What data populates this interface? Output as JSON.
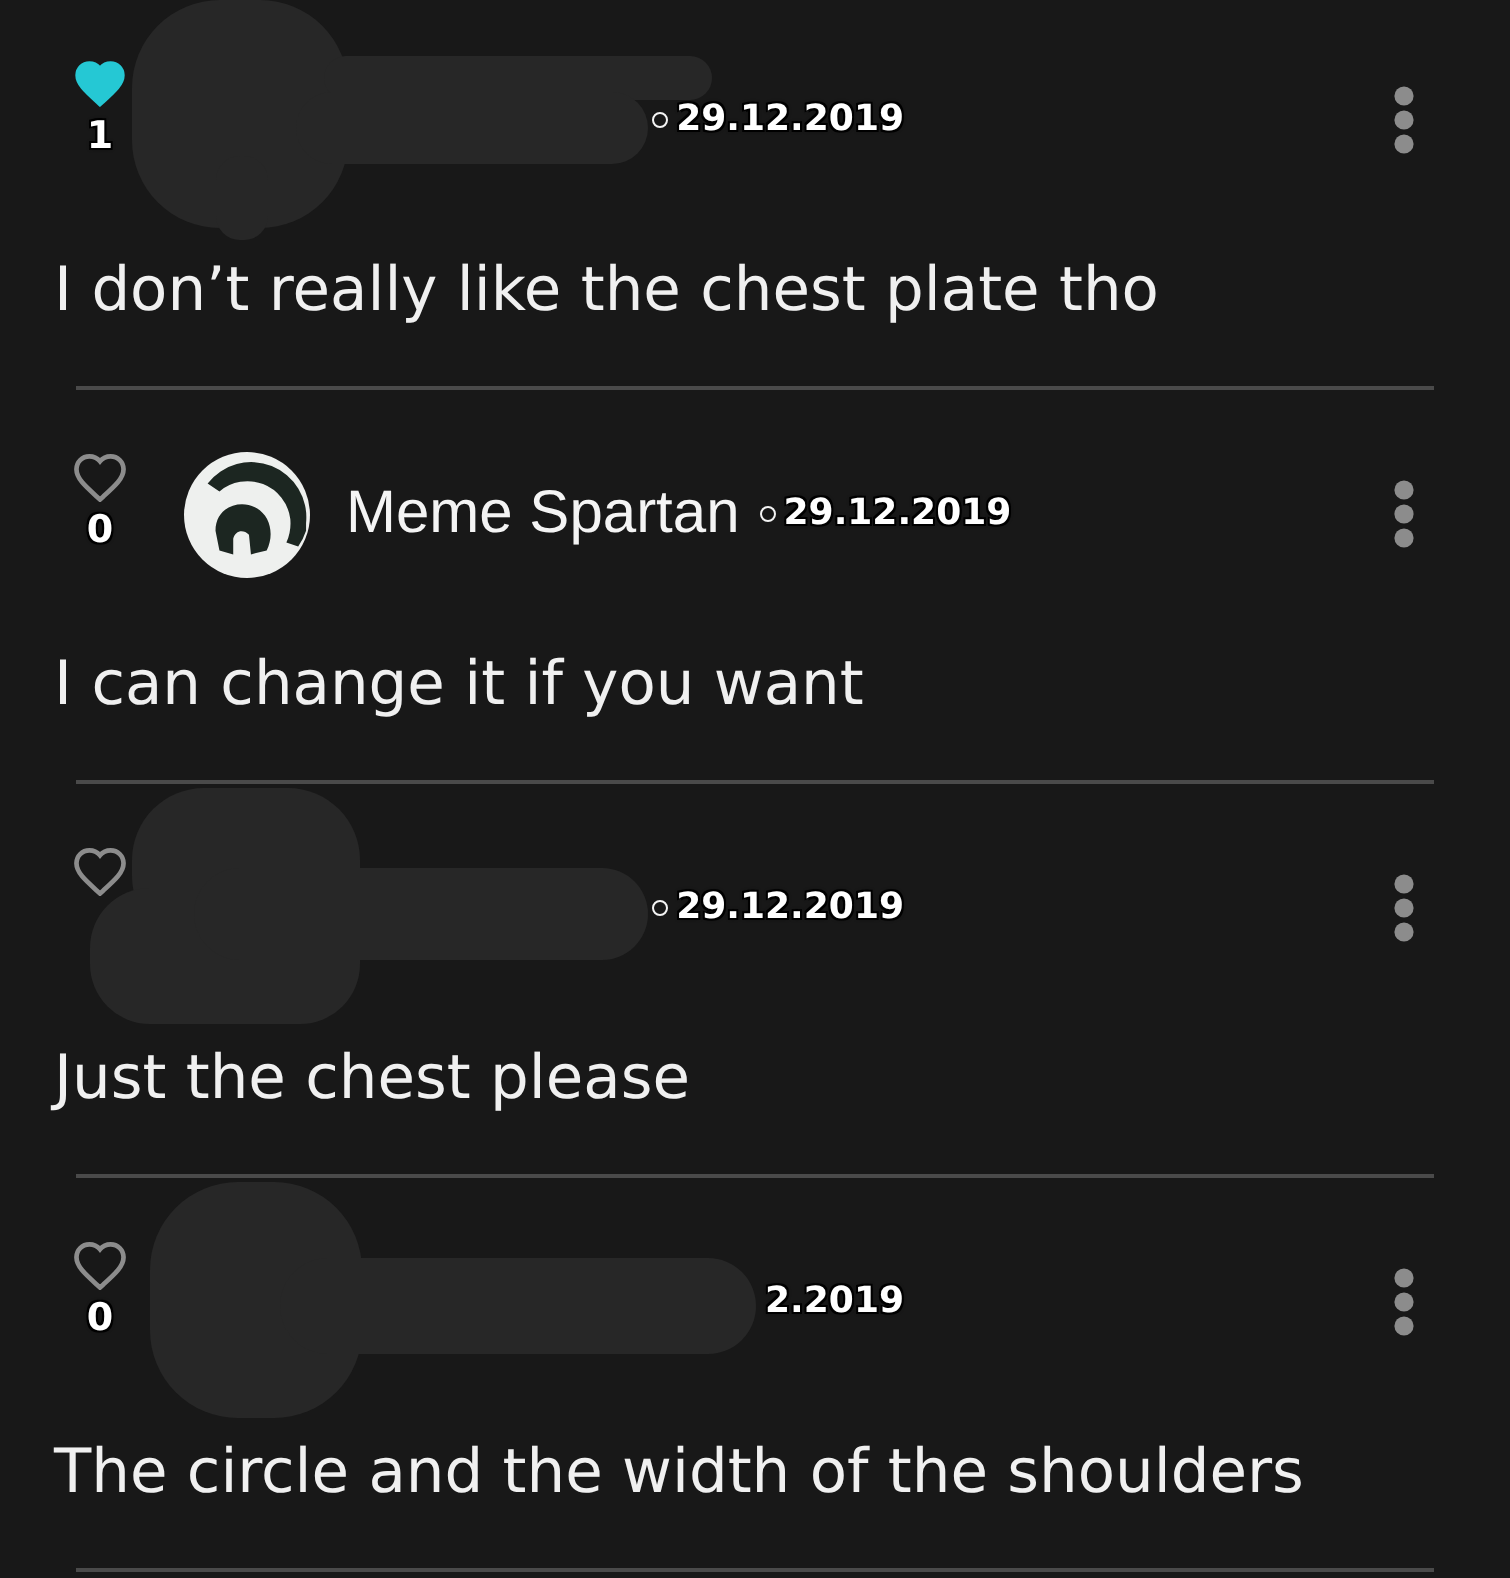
{
  "comments": [
    {
      "liked": true,
      "like_count": "1",
      "redacted": true,
      "bullet": true,
      "date": "29.12.2019",
      "text": "I don’t really like the chest plate tho"
    },
    {
      "liked": false,
      "like_count": "0",
      "redacted": false,
      "avatar": true,
      "author": "Meme Spartan",
      "bullet": true,
      "date": "29.12.2019",
      "text": "I can change it if you want"
    },
    {
      "liked": false,
      "redacted": true,
      "bullet": true,
      "date": "29.12.2019",
      "text": "Just the chest please"
    },
    {
      "liked": false,
      "like_count": "0",
      "redacted": true,
      "bullet": false,
      "date": "2.2019",
      "text": "The circle and the width of the shoulders"
    }
  ]
}
